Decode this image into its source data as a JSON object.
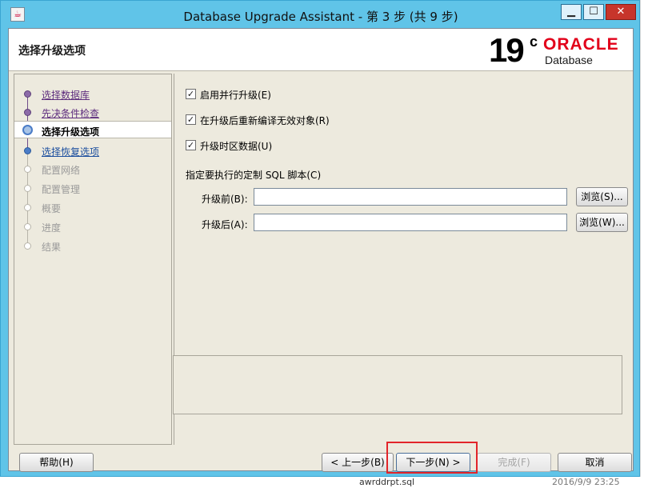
{
  "window": {
    "title": "Database Upgrade Assistant - 第 3 步 (共 9 步)",
    "controls": {
      "minimize": "▁",
      "maximize": "☐",
      "close": "✕"
    }
  },
  "header": {
    "page_title": "选择升级选项",
    "logo": {
      "version": "19",
      "superscript": "c",
      "brand": "ORACLE",
      "product": "Database"
    }
  },
  "nav": {
    "items": [
      {
        "label": "选择数据库",
        "state": "done"
      },
      {
        "label": "先决条件检查",
        "state": "done"
      },
      {
        "label": "选择升级选项",
        "state": "current"
      },
      {
        "label": "选择恢复选项",
        "state": "next"
      },
      {
        "label": "配置网络",
        "state": "disabled"
      },
      {
        "label": "配置管理",
        "state": "disabled"
      },
      {
        "label": "概要",
        "state": "disabled"
      },
      {
        "label": "进度",
        "state": "disabled"
      },
      {
        "label": "结果",
        "state": "disabled"
      }
    ]
  },
  "options": {
    "parallel": {
      "label": "启用并行升级(E)",
      "checked": true
    },
    "recompile": {
      "label": "在升级后重新编译无效对象(R)",
      "checked": true
    },
    "timezone": {
      "label": "升级时区数据(U)",
      "checked": true
    },
    "sql_section": "指定要执行的定制 SQL 脚本(C)",
    "before": {
      "label": "升级前(B):",
      "value": "",
      "browse": "浏览(S)..."
    },
    "after": {
      "label": "升级后(A):",
      "value": "",
      "browse": "浏览(W)..."
    }
  },
  "footer": {
    "help": "帮助(H)",
    "back": "< 上一步(B)",
    "next": "下一步(N) >",
    "finish": "完成(F)",
    "cancel": "取消"
  },
  "background": {
    "sql_file": "awrddrpt.sql",
    "date": "2016/9/9 23:25"
  },
  "colors": {
    "accent": "#e2001a",
    "titlebar": "#60c4e8",
    "highlight": "#e2252a"
  }
}
